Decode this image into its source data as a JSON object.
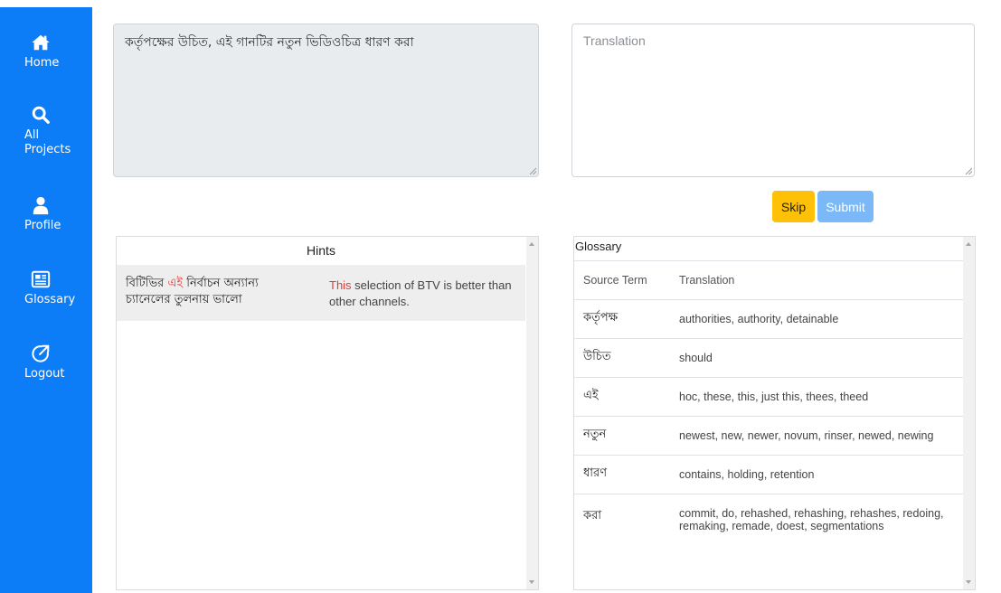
{
  "sidebar": {
    "items": [
      {
        "label": "Home",
        "icon": "home-icon"
      },
      {
        "label": "All Projects",
        "icon": "search-icon"
      },
      {
        "label": "Profile",
        "icon": "user-icon"
      },
      {
        "label": "Glossary",
        "icon": "newspaper-icon"
      },
      {
        "label": "Logout",
        "icon": "external-link-icon"
      }
    ],
    "color": "#0d7cf7"
  },
  "source": {
    "text": "কর্তৃপক্ষের উচিত, এই গানটির নতুন ভিডিওচিত্র ধারণ করা"
  },
  "translation": {
    "value": "",
    "placeholder": "Translation"
  },
  "actions": {
    "skip_label": "Skip",
    "submit_label": "Submit",
    "skip_color": "#ffc107",
    "submit_color": "#7ab8f7"
  },
  "hints": {
    "title": "Hints",
    "items": [
      {
        "src_before": "বিটিভির ",
        "src_highlight": "এই",
        "src_after": " নির্বাচন অন্যান্য চ্যানেলের তুলনায় ভালো",
        "tr_highlight": "This",
        "tr_after": " selection of BTV is better than other channels."
      }
    ],
    "highlight_color": "#e53935"
  },
  "glossary": {
    "title": "Glossary",
    "headers": [
      "Source Term",
      "Translation"
    ],
    "rows": [
      {
        "term": "কর্তৃপক্ষ",
        "translation": "authorities, authority, detainable"
      },
      {
        "term": "উচিত",
        "translation": "should"
      },
      {
        "term": "এই",
        "translation": "hoc, these, this, just this, thees, theed"
      },
      {
        "term": "নতুন",
        "translation": "newest, new, newer, novum, rinser, newed, newing"
      },
      {
        "term": "ধারণ",
        "translation": "contains, holding, retention"
      },
      {
        "term": "করা",
        "translation": "commit, do, rehashed, rehashing, rehashes, redoing, remaking, remade, doest, segmentations"
      }
    ]
  }
}
